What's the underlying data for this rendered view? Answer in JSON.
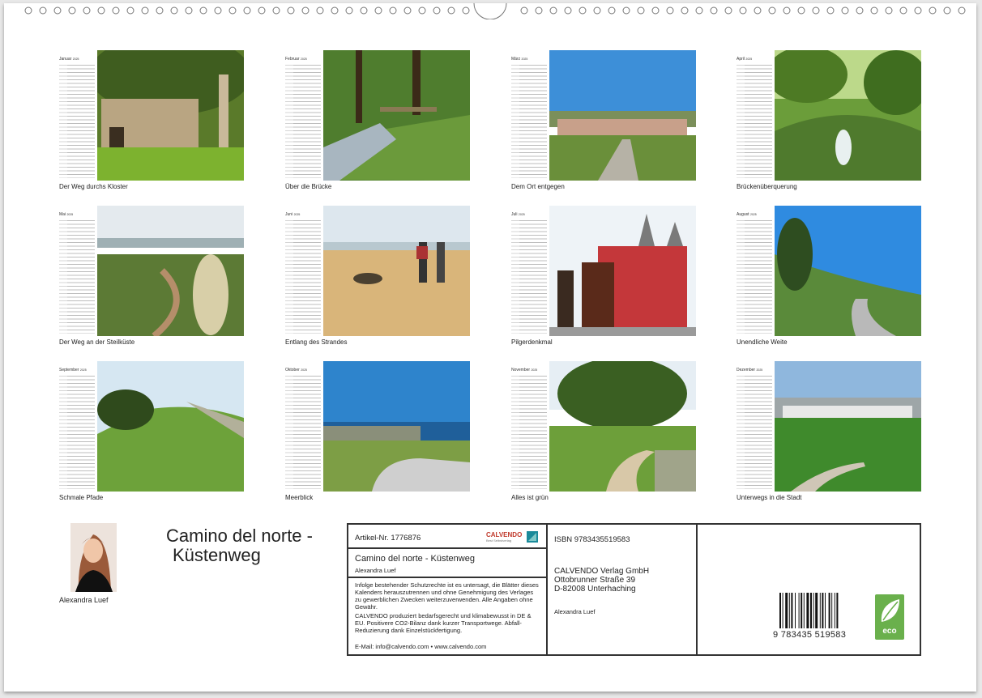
{
  "months": [
    {
      "name": "Januar",
      "year": "2025",
      "caption": "Der Weg durchs Kloster"
    },
    {
      "name": "Februar",
      "year": "2025",
      "caption": "Über die Brücke"
    },
    {
      "name": "März",
      "year": "2025",
      "caption": "Dem Ort entgegen"
    },
    {
      "name": "April",
      "year": "2025",
      "caption": "Brückenüberquerung"
    },
    {
      "name": "Mai",
      "year": "2025",
      "caption": "Der Weg an der Steilküste"
    },
    {
      "name": "Juni",
      "year": "2025",
      "caption": "Entlang des Strandes"
    },
    {
      "name": "Juli",
      "year": "2025",
      "caption": "Pilgerdenkmal"
    },
    {
      "name": "August",
      "year": "2025",
      "caption": "Unendliche Weite"
    },
    {
      "name": "September",
      "year": "2025",
      "caption": "Schmale Pfade"
    },
    {
      "name": "Oktober",
      "year": "2025",
      "caption": "Meerblick"
    },
    {
      "name": "November",
      "year": "2025",
      "caption": "Alles ist grün"
    },
    {
      "name": "Dezember",
      "year": "2025",
      "caption": "Unterwegs in die Stadt"
    }
  ],
  "cover": {
    "title_line1": "Camino del norte -",
    "title_line2": "Küstenweg",
    "author": "Alexandra Luef"
  },
  "info": {
    "article": "Artikel-Nr. 1776876",
    "logo_text": "CALVENDO",
    "logo_sub": "Best Selbstverlag",
    "product_title": "Camino del norte - Küstenweg",
    "product_author": "Alexandra Luef",
    "legal": "Infolge bestehender Schutzrechte ist es untersagt, die Blätter dieses Kalenders herauszutrennen und ohne Genehmigung des Verlages zu gewerblichen Zwecken weiterzuverwenden. Alle Angaben ohne Gewähr.",
    "eco_text": "CALVENDO produziert bedarfsgerecht und klimabewusst in DE & EU. Positivere CO2-Bilanz dank kurzer Transportwege. Abfall-Reduzierung dank Einzelstückfertigung.",
    "contact": "E-Mail: info@calvendo.com • www.calvendo.com",
    "isbn": "ISBN 9783435519583",
    "publisher": "CALVENDO Verlag GmbH",
    "street": "Ottobrunner Straße 39",
    "city": "D-82008 Unterhaching",
    "publisher_author": "Alexandra Luef",
    "barcode_digits": "9 783435 519583",
    "eco_label": "eco"
  },
  "colors": {
    "eco_green": "#6ab04c",
    "calvendo_red": "#c0392b",
    "calvendo_teal": "#1a8a9a"
  }
}
